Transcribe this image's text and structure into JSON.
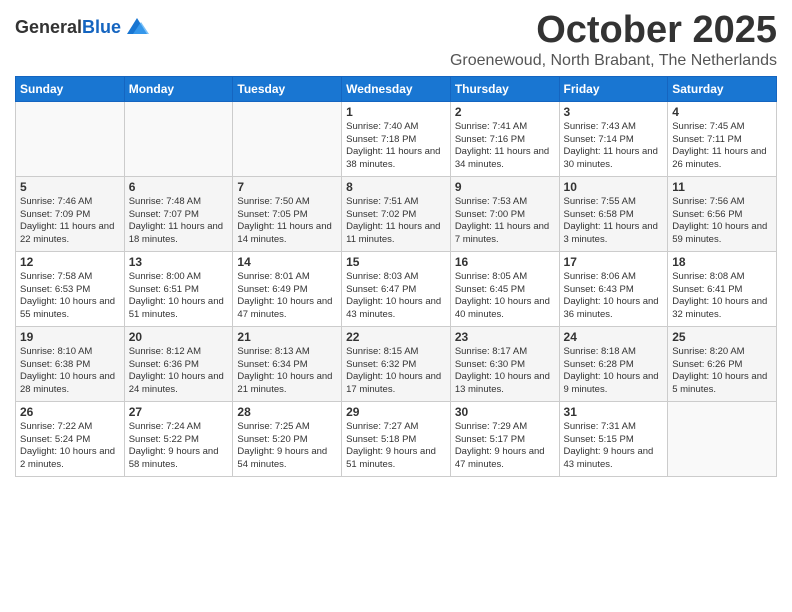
{
  "logo": {
    "line1": "General",
    "line2": "Blue"
  },
  "title": "October 2025",
  "location": "Groenewoud, North Brabant, The Netherlands",
  "days_of_week": [
    "Sunday",
    "Monday",
    "Tuesday",
    "Wednesday",
    "Thursday",
    "Friday",
    "Saturday"
  ],
  "weeks": [
    [
      {
        "day": "",
        "info": ""
      },
      {
        "day": "",
        "info": ""
      },
      {
        "day": "",
        "info": ""
      },
      {
        "day": "1",
        "info": "Sunrise: 7:40 AM\nSunset: 7:18 PM\nDaylight: 11 hours\nand 38 minutes."
      },
      {
        "day": "2",
        "info": "Sunrise: 7:41 AM\nSunset: 7:16 PM\nDaylight: 11 hours\nand 34 minutes."
      },
      {
        "day": "3",
        "info": "Sunrise: 7:43 AM\nSunset: 7:14 PM\nDaylight: 11 hours\nand 30 minutes."
      },
      {
        "day": "4",
        "info": "Sunrise: 7:45 AM\nSunset: 7:11 PM\nDaylight: 11 hours\nand 26 minutes."
      }
    ],
    [
      {
        "day": "5",
        "info": "Sunrise: 7:46 AM\nSunset: 7:09 PM\nDaylight: 11 hours\nand 22 minutes."
      },
      {
        "day": "6",
        "info": "Sunrise: 7:48 AM\nSunset: 7:07 PM\nDaylight: 11 hours\nand 18 minutes."
      },
      {
        "day": "7",
        "info": "Sunrise: 7:50 AM\nSunset: 7:05 PM\nDaylight: 11 hours\nand 14 minutes."
      },
      {
        "day": "8",
        "info": "Sunrise: 7:51 AM\nSunset: 7:02 PM\nDaylight: 11 hours\nand 11 minutes."
      },
      {
        "day": "9",
        "info": "Sunrise: 7:53 AM\nSunset: 7:00 PM\nDaylight: 11 hours\nand 7 minutes."
      },
      {
        "day": "10",
        "info": "Sunrise: 7:55 AM\nSunset: 6:58 PM\nDaylight: 11 hours\nand 3 minutes."
      },
      {
        "day": "11",
        "info": "Sunrise: 7:56 AM\nSunset: 6:56 PM\nDaylight: 10 hours\nand 59 minutes."
      }
    ],
    [
      {
        "day": "12",
        "info": "Sunrise: 7:58 AM\nSunset: 6:53 PM\nDaylight: 10 hours\nand 55 minutes."
      },
      {
        "day": "13",
        "info": "Sunrise: 8:00 AM\nSunset: 6:51 PM\nDaylight: 10 hours\nand 51 minutes."
      },
      {
        "day": "14",
        "info": "Sunrise: 8:01 AM\nSunset: 6:49 PM\nDaylight: 10 hours\nand 47 minutes."
      },
      {
        "day": "15",
        "info": "Sunrise: 8:03 AM\nSunset: 6:47 PM\nDaylight: 10 hours\nand 43 minutes."
      },
      {
        "day": "16",
        "info": "Sunrise: 8:05 AM\nSunset: 6:45 PM\nDaylight: 10 hours\nand 40 minutes."
      },
      {
        "day": "17",
        "info": "Sunrise: 8:06 AM\nSunset: 6:43 PM\nDaylight: 10 hours\nand 36 minutes."
      },
      {
        "day": "18",
        "info": "Sunrise: 8:08 AM\nSunset: 6:41 PM\nDaylight: 10 hours\nand 32 minutes."
      }
    ],
    [
      {
        "day": "19",
        "info": "Sunrise: 8:10 AM\nSunset: 6:38 PM\nDaylight: 10 hours\nand 28 minutes."
      },
      {
        "day": "20",
        "info": "Sunrise: 8:12 AM\nSunset: 6:36 PM\nDaylight: 10 hours\nand 24 minutes."
      },
      {
        "day": "21",
        "info": "Sunrise: 8:13 AM\nSunset: 6:34 PM\nDaylight: 10 hours\nand 21 minutes."
      },
      {
        "day": "22",
        "info": "Sunrise: 8:15 AM\nSunset: 6:32 PM\nDaylight: 10 hours\nand 17 minutes."
      },
      {
        "day": "23",
        "info": "Sunrise: 8:17 AM\nSunset: 6:30 PM\nDaylight: 10 hours\nand 13 minutes."
      },
      {
        "day": "24",
        "info": "Sunrise: 8:18 AM\nSunset: 6:28 PM\nDaylight: 10 hours\nand 9 minutes."
      },
      {
        "day": "25",
        "info": "Sunrise: 8:20 AM\nSunset: 6:26 PM\nDaylight: 10 hours\nand 5 minutes."
      }
    ],
    [
      {
        "day": "26",
        "info": "Sunrise: 7:22 AM\nSunset: 5:24 PM\nDaylight: 10 hours\nand 2 minutes."
      },
      {
        "day": "27",
        "info": "Sunrise: 7:24 AM\nSunset: 5:22 PM\nDaylight: 9 hours\nand 58 minutes."
      },
      {
        "day": "28",
        "info": "Sunrise: 7:25 AM\nSunset: 5:20 PM\nDaylight: 9 hours\nand 54 minutes."
      },
      {
        "day": "29",
        "info": "Sunrise: 7:27 AM\nSunset: 5:18 PM\nDaylight: 9 hours\nand 51 minutes."
      },
      {
        "day": "30",
        "info": "Sunrise: 7:29 AM\nSunset: 5:17 PM\nDaylight: 9 hours\nand 47 minutes."
      },
      {
        "day": "31",
        "info": "Sunrise: 7:31 AM\nSunset: 5:15 PM\nDaylight: 9 hours\nand 43 minutes."
      },
      {
        "day": "",
        "info": ""
      }
    ]
  ]
}
